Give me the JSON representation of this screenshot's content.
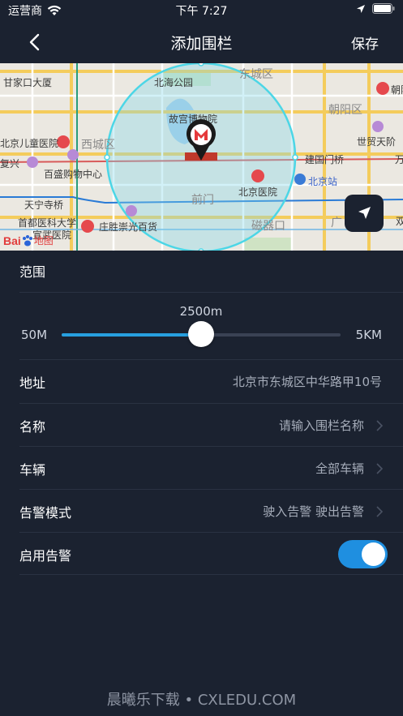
{
  "status": {
    "carrier": "运营商",
    "time": "下午 7:27"
  },
  "nav": {
    "title": "添加围栏",
    "save": "保存"
  },
  "map": {
    "labels": {
      "l1": "甘家口大厦",
      "l2": "北海公园",
      "l3": "东城区",
      "l4": "朝阳",
      "l5": "故宫博物院",
      "l6": "朝阳区",
      "l7": "北京儿童医院",
      "l8": "西城区",
      "l9": "世贸天阶",
      "l10": "百盛购物中心",
      "l11": "建国门桥",
      "l12": "万",
      "l13": "北京站",
      "l14": "北京医院",
      "l15": "天宁寺桥",
      "l16": "前门",
      "l17": "首都医科大学",
      "l18": "庄胜崇光百货",
      "l19": "宣武医院",
      "l20": "磁器口",
      "l21": "广",
      "l22": "双",
      "l23": "复兴",
      "logo_bai": "Bai",
      "logo_du": "地图"
    },
    "accent_fence": "#4cd6e6"
  },
  "range": {
    "title": "范围",
    "value": "2500m",
    "min": "50M",
    "max": "5KM",
    "percent": 0.5
  },
  "rows": {
    "address": {
      "label": "地址",
      "value": "北京市东城区中华路甲10号"
    },
    "name": {
      "label": "名称",
      "placeholder": "请输入围栏名称"
    },
    "vehicle": {
      "label": "车辆",
      "value": "全部车辆"
    },
    "alarm_mode": {
      "label": "告警模式",
      "value": "驶入告警 驶出告警"
    },
    "enable_alarm": {
      "label": "启用告警",
      "on": true
    }
  },
  "watermark": "晨曦乐下载 • CXLEDU.COM",
  "colors": {
    "background": "#1b2230",
    "accent": "#1f8fe0",
    "slider": "#27a0e0"
  }
}
